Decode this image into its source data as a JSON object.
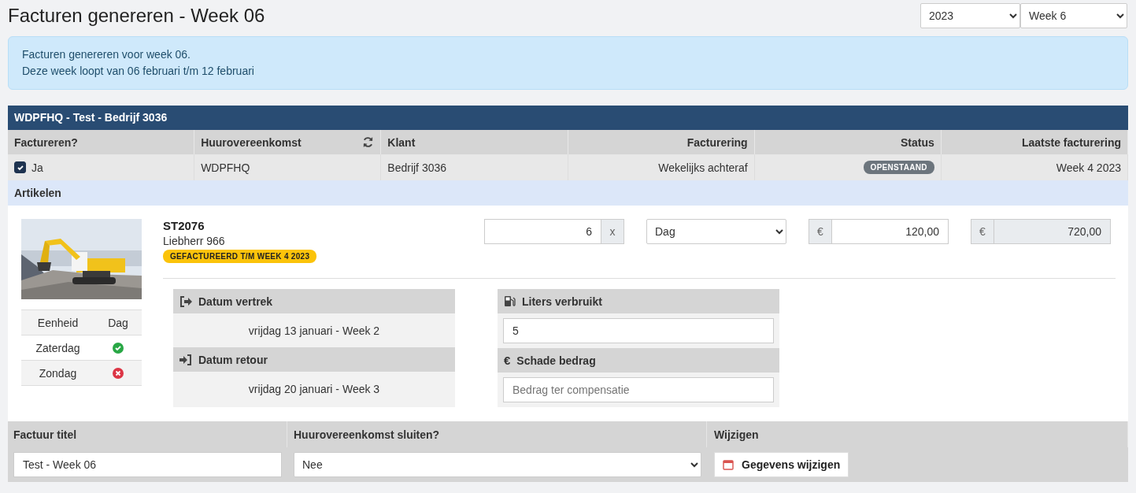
{
  "page": {
    "title": "Facturen genereren - Week 06"
  },
  "filters": [
    {
      "value": "2023"
    },
    {
      "value": "Week 6"
    }
  ],
  "alert": {
    "lines": [
      "Facturen genereren voor week 06.",
      "Deze week loopt van 06 februari t/m 12 februari"
    ]
  },
  "contract": {
    "title": "WDPFHQ - Test - Bedrijf 3036",
    "columns": [
      {
        "label": "Factureren?"
      },
      {
        "label": "Huurovereenkomst",
        "refresh": true
      },
      {
        "label": "Klant"
      },
      {
        "label": "Facturering"
      },
      {
        "label": "Status"
      },
      {
        "label": "Laatste facturering"
      }
    ],
    "row": {
      "invoice": {
        "checked": true,
        "label": "Ja"
      },
      "agreement": "WDPFHQ",
      "client": "Bedrijf 3036",
      "billing": "Wekelijks achteraf",
      "status": "OPENSTAAND",
      "last_invoice": "Week 4 2023"
    },
    "section": "Artikelen"
  },
  "article": {
    "code": "ST2076",
    "name": "Liebherr 966",
    "badge": "GEFACTUREERD T/M WEEK 4 2023",
    "units": {
      "header": [
        "Eenheid",
        "Dag"
      ],
      "rows": [
        {
          "label": "Zaterdag",
          "included": true
        },
        {
          "label": "Zondag",
          "included": false
        }
      ]
    },
    "quantity": "6",
    "multiplier": "x",
    "unit": "Dag",
    "price": {
      "currency": "€",
      "value": "120,00"
    },
    "total": {
      "currency": "€",
      "value": "720,00"
    },
    "dates": [
      {
        "kind": "departure",
        "label": "Datum vertrek",
        "value": "vrijdag 13 januari - Week 2"
      },
      {
        "kind": "return",
        "label": "Datum retour",
        "value": "vrijdag 20 januari - Week 3"
      }
    ],
    "extras": [
      {
        "kind": "fuel",
        "label": "Liters verbruikt",
        "value": "5"
      },
      {
        "kind": "damage",
        "icon": "€",
        "label": "Schade bedrag",
        "placeholder": "Bedrag ter compensatie"
      }
    ]
  },
  "footer": {
    "columns": [
      "Factuur titel",
      "Huurovereenkomst sluiten?",
      "Wijzigen"
    ],
    "title_value": "Test - Week 06",
    "close_value": "Nee",
    "edit_button": "Gegevens wijzigen"
  }
}
